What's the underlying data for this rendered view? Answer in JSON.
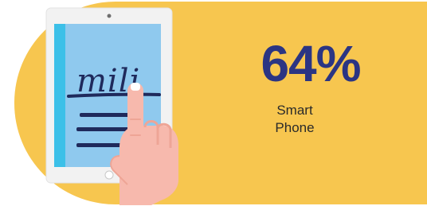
{
  "colors": {
    "background_band": "#f7c64f",
    "accent_text": "#2b3583",
    "tablet_frame": "#f2f2f2",
    "tablet_screen": "#8fc9ee",
    "tablet_side_strip": "#3cc0e8",
    "ink": "#1f2a5c",
    "skin": "#f7b9ad",
    "skin_shadow": "#eea596"
  },
  "illustration": {
    "icon": "tablet-hand-signature-icon",
    "signature_text": "mili"
  },
  "stat": {
    "value": "64%",
    "label_line1": "Smart",
    "label_line2": "Phone"
  }
}
